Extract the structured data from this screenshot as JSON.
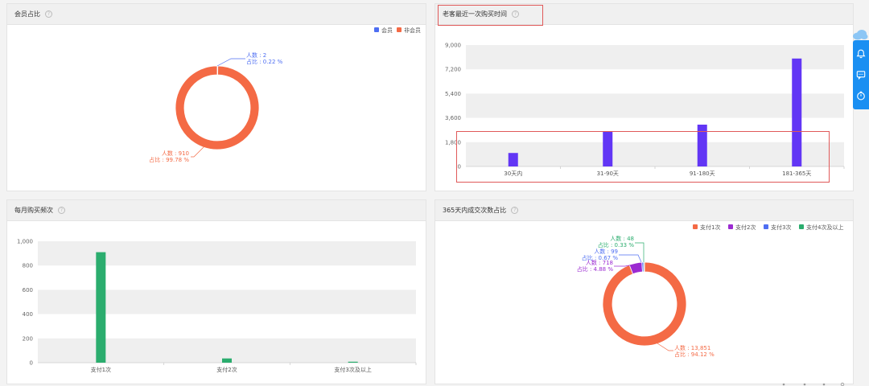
{
  "colors": {
    "orange": "#f46a45",
    "blue_member": "#4e6ef2",
    "purple": "#6236f5",
    "green": "#2bad6e",
    "violet": "#9b2ad1",
    "gray_band": "#efefef",
    "rail_blue": "#1a8ff2"
  },
  "cards": {
    "member_ratio": {
      "title": "会员占比",
      "legend": [
        "会员",
        "非会员"
      ],
      "chart_data": {
        "type": "pie",
        "donut": true,
        "labels": [
          "会员",
          "非会员"
        ],
        "values": [
          2,
          910
        ],
        "percents": [
          "0.22 %",
          "99.78 %"
        ],
        "annotations": [
          {
            "line1": "人数 : 2",
            "line2": "占比 : 0.22 %"
          },
          {
            "line1": "人数 : 910",
            "line2": "占比 : 99.78 %"
          }
        ]
      }
    },
    "last_purchase": {
      "title": "老客最近一次购买时间",
      "chart_data": {
        "type": "bar",
        "categories": [
          "30天内",
          "31-90天",
          "91-180天",
          "181-365天"
        ],
        "values": [
          1000,
          2600,
          3100,
          8000
        ],
        "ylim": [
          0,
          9000
        ],
        "yticks": [
          "0",
          "1,800",
          "3,600",
          "5,400",
          "7,200",
          "9,000"
        ],
        "grid": "banded"
      }
    },
    "monthly_freq": {
      "title": "每月购买频次",
      "chart_data": {
        "type": "bar",
        "categories": [
          "支付1次",
          "支付2次",
          "支付3次及以上"
        ],
        "values": [
          910,
          35,
          8
        ],
        "ylim": [
          0,
          1000
        ],
        "yticks": [
          "0",
          "200",
          "400",
          "600",
          "800",
          "1,000"
        ],
        "grid": "banded"
      }
    },
    "deal_count": {
      "title": "365天内成交次数占比",
      "legend": [
        "支付1次",
        "支付2次",
        "支付3次",
        "支付4次及以上"
      ],
      "chart_data": {
        "type": "pie",
        "donut": true,
        "labels": [
          "支付1次",
          "支付2次",
          "支付3次",
          "支付4次及以上"
        ],
        "values": [
          13851,
          718,
          99,
          48
        ],
        "annotations": [
          {
            "line1": "人数 : 13,851",
            "line2": "占比 : 94.12 %"
          },
          {
            "line1": "人数 : 718",
            "line2": "占比 : 4.88 %"
          },
          {
            "line1": "人数 : 99",
            "line2": "占比 : 0.67 %"
          },
          {
            "line1": "人数 : 48",
            "line2": "占比 : 0.33 %"
          }
        ]
      }
    }
  }
}
